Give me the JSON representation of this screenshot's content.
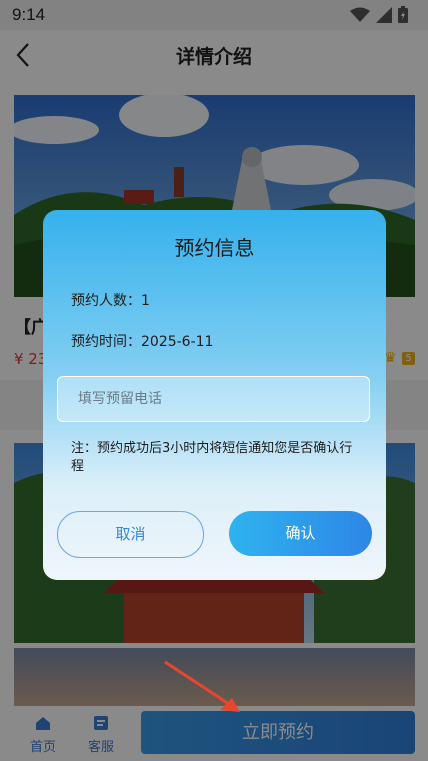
{
  "status_bar": {
    "time": "9:14"
  },
  "header": {
    "title": "详情介绍"
  },
  "card": {
    "title_prefix": "【广",
    "price_prefix": "¥ 23",
    "badge": "5"
  },
  "tab_bar": {
    "home_label": "首页",
    "service_label": "客服"
  },
  "bottom_button": {
    "label": "立即预约"
  },
  "modal": {
    "title": "预约信息",
    "people_label": "预约人数：1",
    "time_label": "预约时间：2025-6-11",
    "phone_placeholder": "填写预留电话",
    "note": "注：预约成功后3小时内将短信通知您是否确认行程",
    "cancel_label": "取消",
    "confirm_label": "确认"
  },
  "colors": {
    "accent": "#2e86e6",
    "price": "#e03b2f",
    "tab_label": "#3b7bd8"
  }
}
